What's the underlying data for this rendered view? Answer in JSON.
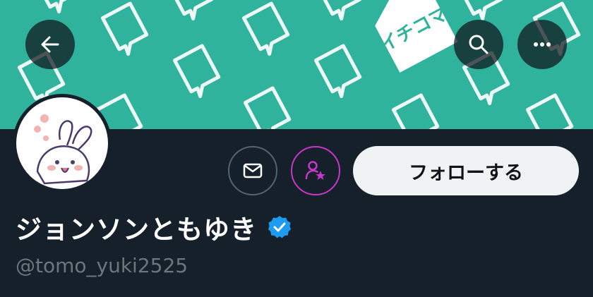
{
  "banner": {
    "background_color": "#2fb39d",
    "pattern_color": "#ffffff",
    "sign_text": "イチコマ"
  },
  "header": {
    "back_icon": "arrow-left-icon",
    "search_icon": "search-icon",
    "more_icon": "more-horizontal-icon"
  },
  "profile": {
    "display_name": "ジョンソンともゆき",
    "handle": "@tomo_yuki2525",
    "verified": true,
    "verified_color": "#1d9bf0",
    "avatar_icon": "rabbit-avatar"
  },
  "actions": {
    "message_icon": "envelope-icon",
    "subscribe_icon": "person-star-icon",
    "subscribe_color": "#c936cc",
    "follow_label": "フォローする"
  }
}
